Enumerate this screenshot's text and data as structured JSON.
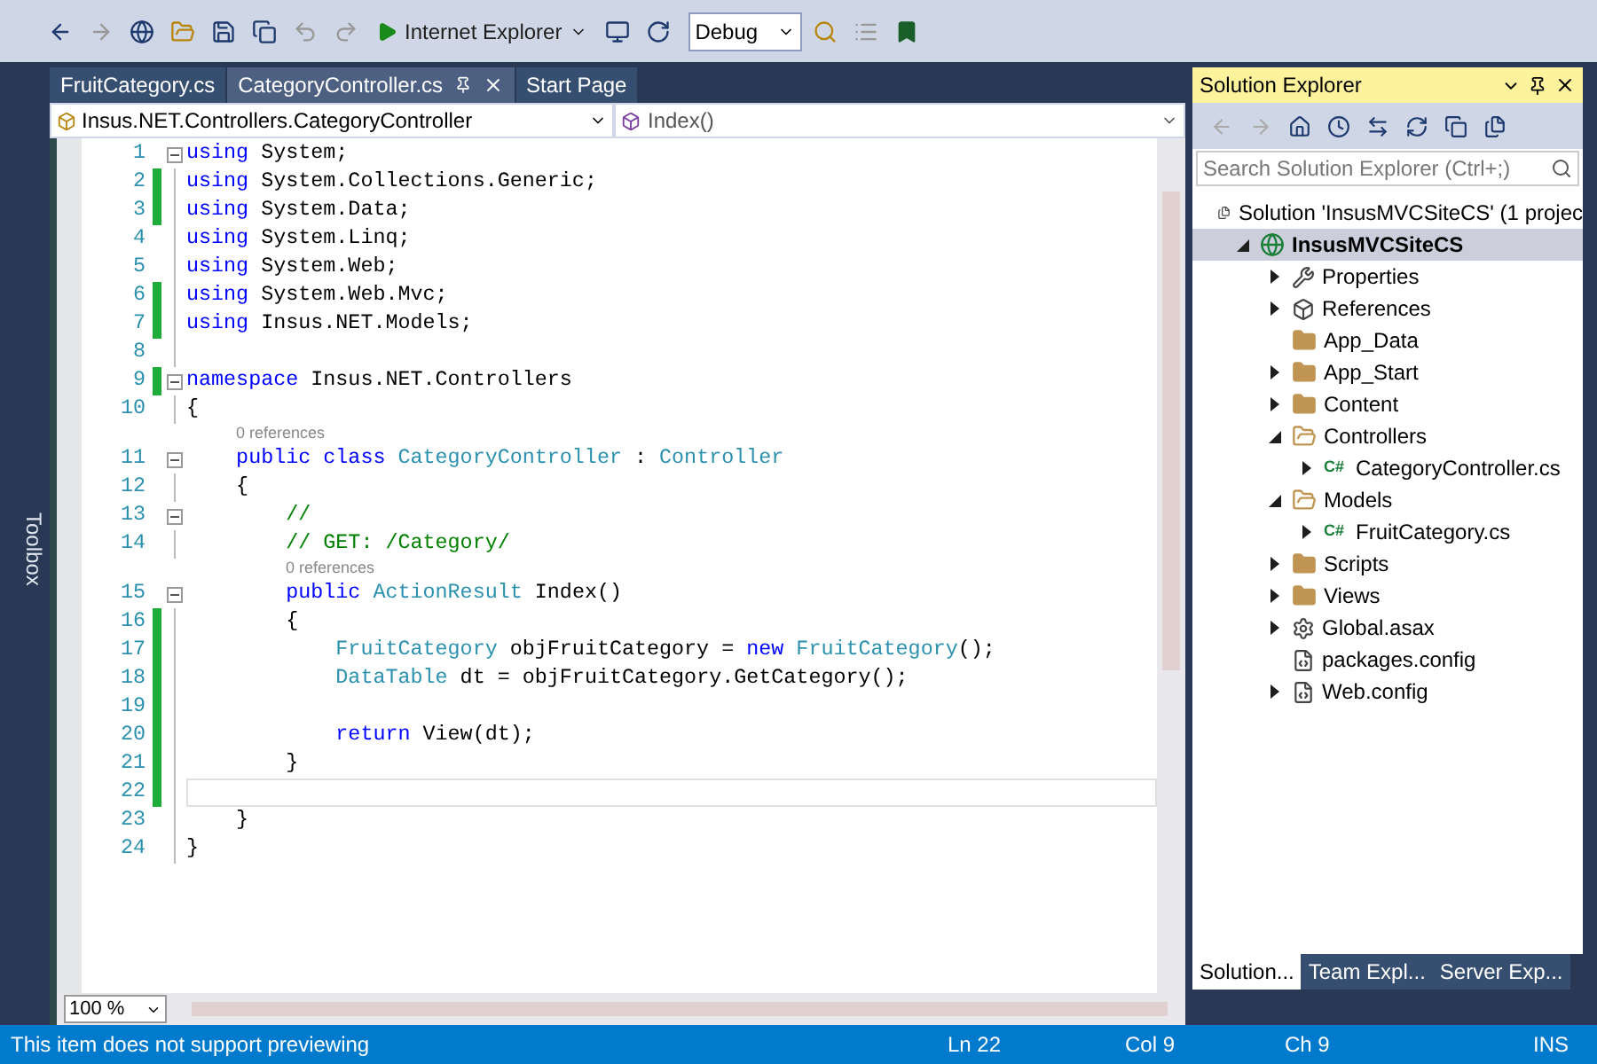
{
  "toolbar": {
    "run_target": "Internet Explorer",
    "configuration": "Debug"
  },
  "toolbox": {
    "label": "Toolbox"
  },
  "tabs": [
    {
      "label": "FruitCategory.cs",
      "selected": false,
      "pinned": false
    },
    {
      "label": "CategoryController.cs",
      "selected": true,
      "pinned": true
    },
    {
      "label": "Start Page",
      "selected": false,
      "pinned": false
    }
  ],
  "navigation_bar": {
    "type_scope": "Insus.NET.Controllers.CategoryController",
    "member": "Index()"
  },
  "editor": {
    "lines": [
      {
        "kind": "code",
        "number": "1",
        "changed": false,
        "fold": true,
        "current": false,
        "tokens": [
          {
            "kind": "keyword",
            "text": "using"
          },
          {
            "kind": "plain",
            "text": " System;"
          }
        ]
      },
      {
        "kind": "code",
        "number": "2",
        "changed": true,
        "fold": false,
        "current": false,
        "tokens": [
          {
            "kind": "keyword",
            "text": "using"
          },
          {
            "kind": "plain",
            "text": " System.Collections.Generic;"
          }
        ]
      },
      {
        "kind": "code",
        "number": "3",
        "changed": true,
        "fold": false,
        "current": false,
        "tokens": [
          {
            "kind": "keyword",
            "text": "using"
          },
          {
            "kind": "plain",
            "text": " System.Data;"
          }
        ]
      },
      {
        "kind": "code",
        "number": "4",
        "changed": false,
        "fold": false,
        "current": false,
        "tokens": [
          {
            "kind": "keyword",
            "text": "using"
          },
          {
            "kind": "plain",
            "text": " System.Linq;"
          }
        ]
      },
      {
        "kind": "code",
        "number": "5",
        "changed": false,
        "fold": false,
        "current": false,
        "tokens": [
          {
            "kind": "keyword",
            "text": "using"
          },
          {
            "kind": "plain",
            "text": " System.Web;"
          }
        ]
      },
      {
        "kind": "code",
        "number": "6",
        "changed": true,
        "fold": false,
        "current": false,
        "tokens": [
          {
            "kind": "keyword",
            "text": "using"
          },
          {
            "kind": "plain",
            "text": " System.Web.Mvc;"
          }
        ]
      },
      {
        "kind": "code",
        "number": "7",
        "changed": true,
        "fold": false,
        "current": false,
        "tokens": [
          {
            "kind": "keyword",
            "text": "using"
          },
          {
            "kind": "plain",
            "text": " Insus.NET.Models;"
          }
        ]
      },
      {
        "kind": "code",
        "number": "8",
        "changed": false,
        "fold": false,
        "current": false
      },
      {
        "kind": "code",
        "number": "9",
        "changed": true,
        "fold": true,
        "current": false,
        "tokens": [
          {
            "kind": "keyword",
            "text": "namespace"
          },
          {
            "kind": "plain",
            "text": " Insus.NET.Controllers"
          }
        ]
      },
      {
        "kind": "code",
        "number": "10",
        "changed": false,
        "fold": false,
        "current": false,
        "tokens": [
          {
            "kind": "plain",
            "text": "{"
          }
        ]
      },
      {
        "kind": "lens",
        "text": "0 references"
      },
      {
        "kind": "code",
        "number": "11",
        "changed": false,
        "fold": true,
        "current": false,
        "tokens": [
          {
            "kind": "keyword",
            "text": "    public class"
          },
          {
            "kind": "type",
            "text": " CategoryController"
          },
          {
            "kind": "plain",
            "text": " : "
          },
          {
            "kind": "type",
            "text": "Controller"
          }
        ]
      },
      {
        "kind": "code",
        "number": "12",
        "changed": false,
        "fold": false,
        "current": false,
        "tokens": [
          {
            "kind": "plain",
            "text": "    {"
          }
        ]
      },
      {
        "kind": "code",
        "number": "13",
        "changed": false,
        "fold": true,
        "current": false,
        "tokens": [
          {
            "kind": "comment",
            "text": "        //"
          }
        ]
      },
      {
        "kind": "code",
        "number": "14",
        "changed": false,
        "fold": false,
        "current": false,
        "tokens": [
          {
            "kind": "comment",
            "text": "        // GET: /Category/"
          }
        ]
      },
      {
        "kind": "lens",
        "text": "0 references"
      },
      {
        "kind": "code",
        "number": "15",
        "changed": false,
        "fold": true,
        "current": false,
        "tokens": [
          {
            "kind": "keyword",
            "text": "        public"
          },
          {
            "kind": "type",
            "text": " ActionResult"
          },
          {
            "kind": "plain",
            "text": " Index()"
          }
        ]
      },
      {
        "kind": "code",
        "number": "16",
        "changed": true,
        "fold": false,
        "current": false,
        "tokens": [
          {
            "kind": "plain",
            "text": "        {"
          }
        ]
      },
      {
        "kind": "code",
        "number": "17",
        "changed": true,
        "fold": false,
        "current": false,
        "tokens": [
          {
            "kind": "type",
            "text": "            FruitCategory"
          },
          {
            "kind": "plain",
            "text": " objFruitCategory = "
          },
          {
            "kind": "keyword",
            "text": "new"
          },
          {
            "kind": "type",
            "text": " FruitCategory"
          },
          {
            "kind": "plain",
            "text": "();"
          }
        ]
      },
      {
        "kind": "code",
        "number": "18",
        "changed": true,
        "fold": false,
        "current": false,
        "tokens": [
          {
            "kind": "type",
            "text": "            DataTable"
          },
          {
            "kind": "plain",
            "text": " dt = objFruitCategory.GetCategory();"
          }
        ]
      },
      {
        "kind": "code",
        "number": "19",
        "changed": true,
        "fold": false,
        "current": false
      },
      {
        "kind": "code",
        "number": "20",
        "changed": true,
        "fold": false,
        "current": false,
        "tokens": [
          {
            "kind": "keyword",
            "text": "            return"
          },
          {
            "kind": "plain",
            "text": " View(dt);"
          }
        ]
      },
      {
        "kind": "code",
        "number": "21",
        "changed": true,
        "fold": false,
        "current": false,
        "tokens": [
          {
            "kind": "plain",
            "text": "        }"
          }
        ]
      },
      {
        "kind": "code",
        "number": "22",
        "changed": true,
        "fold": false,
        "current": true
      },
      {
        "kind": "code",
        "number": "23",
        "changed": false,
        "fold": false,
        "current": false,
        "tokens": [
          {
            "kind": "plain",
            "text": "    }"
          }
        ]
      },
      {
        "kind": "code",
        "number": "24",
        "changed": false,
        "fold": false,
        "current": false,
        "tokens": [
          {
            "kind": "plain",
            "text": "}"
          }
        ]
      }
    ],
    "zoom": "100 %"
  },
  "solution_explorer": {
    "title": "Solution Explorer",
    "search": {
      "placeholder": "Search Solution Explorer (Ctrl+;)"
    },
    "tree": [
      {
        "label": "Solution 'InsusMVCSiteCS' (1 projec",
        "kind": "solution",
        "selected": false,
        "children": [
          {
            "label": "InsusMVCSiteCS",
            "kind": "project",
            "selected": true,
            "expanded": true,
            "children": [
              {
                "label": "Properties",
                "kind": "properties",
                "selected": false,
                "expanded": false
              },
              {
                "label": "References",
                "kind": "references",
                "selected": false,
                "expanded": false
              },
              {
                "label": "App_Data",
                "kind": "folder",
                "selected": false
              },
              {
                "label": "App_Start",
                "kind": "folder",
                "selected": false,
                "expanded": false
              },
              {
                "label": "Content",
                "kind": "folder",
                "selected": false,
                "expanded": false
              },
              {
                "label": "Controllers",
                "kind": "open-folder",
                "selected": false,
                "expanded": true,
                "children": [
                  {
                    "label": "CategoryController.cs",
                    "kind": "csharp",
                    "badge": "C#",
                    "selected": false,
                    "expanded": false
                  }
                ]
              },
              {
                "label": "Models",
                "kind": "open-folder",
                "selected": false,
                "expanded": true,
                "children": [
                  {
                    "label": "FruitCategory.cs",
                    "kind": "csharp",
                    "badge": "C#",
                    "selected": false,
                    "expanded": false
                  }
                ]
              },
              {
                "label": "Scripts",
                "kind": "folder",
                "selected": false,
                "expanded": false
              },
              {
                "label": "Views",
                "kind": "folder",
                "selected": false,
                "expanded": false
              },
              {
                "label": "Global.asax",
                "kind": "global",
                "selected": false,
                "expanded": false
              },
              {
                "label": "packages.config",
                "kind": "config",
                "selected": false
              },
              {
                "label": "Web.config",
                "kind": "config",
                "selected": false,
                "expanded": false
              }
            ]
          }
        ]
      }
    ],
    "bottom_tabs": [
      {
        "label": "Solution...",
        "selected": true
      },
      {
        "label": "Team Expl...",
        "selected": false
      },
      {
        "label": "Server Exp...",
        "selected": false
      }
    ]
  },
  "status_bar": {
    "message": "This item does not support previewing",
    "line": "Ln 22",
    "column": "Col 9",
    "char": "Ch 9",
    "mode": "INS"
  }
}
